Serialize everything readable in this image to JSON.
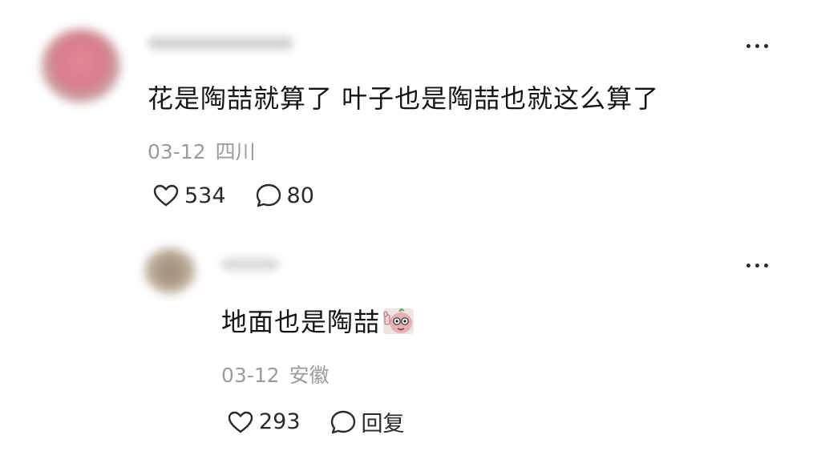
{
  "comment": {
    "text": "花是陶喆就算了 叶子也是陶喆也就这么算了",
    "date": "03-12",
    "location": "四川",
    "likes": "534",
    "comments": "80"
  },
  "reply": {
    "text": "地面也是陶喆",
    "sticker_icon": "thumbs-up-mascot-sticker",
    "date": "03-12",
    "location": "安徽",
    "likes": "293",
    "reply_label": "回复"
  },
  "icons": {
    "like": "heart-outline-icon",
    "comment": "speech-bubble-icon",
    "more": "more-dots-icon"
  },
  "colors": {
    "text": "#151515",
    "meta": "#9b9b9b",
    "icon": "#2a2a2a"
  }
}
